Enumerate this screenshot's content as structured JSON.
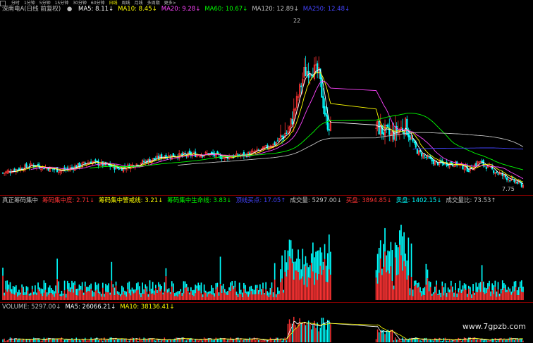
{
  "toolbar": {
    "items": [
      "分时",
      "1分钟",
      "5分钟",
      "15分钟",
      "30分钟",
      "60分钟",
      "日线",
      "周线",
      "月线",
      "多周期",
      "更多>"
    ],
    "active_index": 6
  },
  "price_panel": {
    "title": "深南电A(日线 前复权)",
    "ma": [
      {
        "label": "MA5: 8.11↓",
        "color": "#ffffff"
      },
      {
        "label": "MA10: 8.45↓",
        "color": "#ffff00"
      },
      {
        "label": "MA20: 9.28↓",
        "color": "#ff44ff"
      },
      {
        "label": "MA60: 10.67↓",
        "color": "#00ff00"
      },
      {
        "label": "MA120: 12.89↓",
        "color": "#c0c0c0"
      },
      {
        "label": "MA250: 12.48↓",
        "color": "#4444ff"
      }
    ],
    "high_label": "22",
    "low_label": "7.75"
  },
  "indicator_panel": {
    "items": [
      {
        "label": "真正筹码集中",
        "color": "#c0c0c0"
      },
      {
        "label": "筹码集中度: 2.71↓",
        "color": "#ff3333"
      },
      {
        "label": "筹码集中警戒线: 3.21↓",
        "color": "#ffff00"
      },
      {
        "label": "筹码集中生命线: 3.83↓",
        "color": "#00ff00"
      },
      {
        "label": "顶线买点: 17.05↑",
        "color": "#4444ff"
      },
      {
        "label": "成交量: 5297.00↓",
        "color": "#c0c0c0"
      },
      {
        "label": "买盘: 3894.85↓",
        "color": "#ff3333"
      },
      {
        "label": "卖盘: 1402.15↓",
        "color": "#00ffff"
      },
      {
        "label": "成交量比: 73.53↑",
        "color": "#c0c0c0"
      }
    ]
  },
  "volume_panel": {
    "items": [
      {
        "label": "VOLUME: 5297.00↓",
        "color": "#c0c0c0"
      },
      {
        "label": "MA5: 26066.21↓",
        "color": "#ffffff"
      },
      {
        "label": "MA10: 38136.41↓",
        "color": "#ffff00"
      }
    ]
  },
  "watermark": "www.7gpzb.com",
  "colors": {
    "up": "#ff3333",
    "down": "#00ffff",
    "background": "#000000"
  },
  "chart_data": {
    "type": "bar",
    "candles": {
      "n": 240,
      "price_range": [
        7.5,
        22.5
      ],
      "close_anchors": [
        [
          0,
          8.9
        ],
        [
          20,
          9.6
        ],
        [
          40,
          9.1
        ],
        [
          60,
          9.9
        ],
        [
          80,
          9.3
        ],
        [
          110,
          10.4
        ],
        [
          140,
          10.6
        ],
        [
          150,
          10.3
        ],
        [
          165,
          10.5
        ],
        [
          175,
          10.9
        ],
        [
          185,
          11.5
        ],
        [
          195,
          12.8
        ],
        [
          200,
          15.2
        ],
        [
          205,
          17.8
        ],
        [
          210,
          18.2
        ],
        [
          215,
          17.6
        ],
        [
          220,
          13.5
        ],
        [
          223,
          13.0
        ]
      ],
      "close_anchors_2": [
        [
          0,
          13.0
        ],
        [
          10,
          12.2
        ],
        [
          20,
          13.1
        ],
        [
          28,
          10.8
        ],
        [
          40,
          9.8
        ],
        [
          55,
          9.7
        ],
        [
          63,
          9.2
        ],
        [
          70,
          9.9
        ],
        [
          80,
          9.1
        ],
        [
          90,
          8.4
        ],
        [
          100,
          7.8
        ]
      ]
    }
  }
}
